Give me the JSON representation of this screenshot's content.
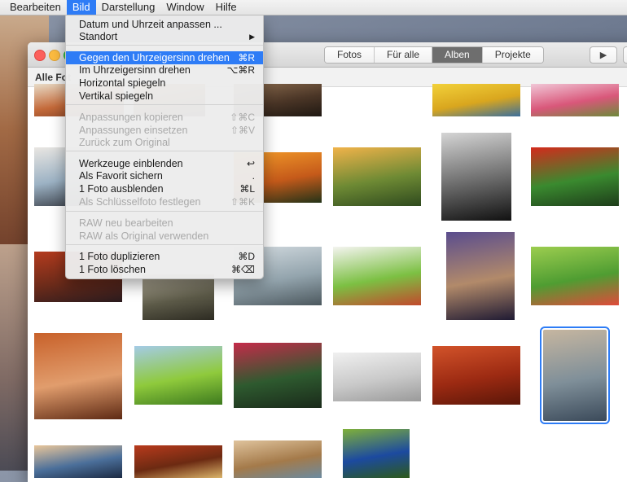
{
  "menubar": {
    "items": [
      "Bearbeiten",
      "Bild",
      "Darstellung",
      "Window",
      "Hilfe"
    ],
    "active_index": 1
  },
  "window": {
    "tabs": [
      "Fotos",
      "Für alle",
      "Alben",
      "Projekte"
    ],
    "active_tab": "Alben",
    "play_icon": "play-icon",
    "breadcrumb": "Alle Fot"
  },
  "bild_menu": {
    "items": [
      {
        "label": "Datum und Uhrzeit anpassen ...",
        "shortcut": "",
        "disabled": false
      },
      {
        "label": "Standort",
        "shortcut": "▶",
        "disabled": false
      },
      {
        "label": "Gegen den Uhrzeigersinn drehen",
        "shortcut": "⌘R",
        "disabled": false,
        "highlighted": true
      },
      {
        "label": "Im Uhrzeigersinn drehen",
        "shortcut": "⌥⌘R",
        "disabled": false
      },
      {
        "label": "Horizontal spiegeln",
        "shortcut": "",
        "disabled": false
      },
      {
        "label": "Vertikal spiegeln",
        "shortcut": "",
        "disabled": false
      },
      {
        "label": "Anpassungen kopieren",
        "shortcut": "⇧⌘C",
        "disabled": true
      },
      {
        "label": "Anpassungen einsetzen",
        "shortcut": "⇧⌘V",
        "disabled": true
      },
      {
        "label": "Zurück zum Original",
        "shortcut": "",
        "disabled": true
      },
      {
        "label": "Werkzeuge einblenden",
        "shortcut": "↩",
        "disabled": false
      },
      {
        "label": "Als Favorit sichern",
        "shortcut": ".",
        "disabled": false
      },
      {
        "label": "1 Foto ausblenden",
        "shortcut": "⌘L",
        "disabled": false
      },
      {
        "label": "Als Schlüsselfoto festlegen",
        "shortcut": "⇧⌘K",
        "disabled": true
      },
      {
        "label": "RAW neu bearbeiten",
        "shortcut": "",
        "disabled": true
      },
      {
        "label": "RAW als Original verwenden",
        "shortcut": "",
        "disabled": true
      },
      {
        "label": "1 Foto duplizieren",
        "shortcut": "⌘D",
        "disabled": false
      },
      {
        "label": "1 Foto löschen",
        "shortcut": "⌘⌫",
        "disabled": false
      }
    ]
  },
  "photos": [
    {
      "name": "photo-swan-dawn",
      "colors": [
        "#e8dcc8",
        "#c46a3a",
        "#7a3c22"
      ]
    },
    {
      "name": "photo-path-sunset",
      "colors": [
        "#d9a25a",
        "#8a5a2b",
        "#3b2a1e"
      ]
    },
    {
      "name": "photo-pier-dusk",
      "colors": [
        "#8a6b4e",
        "#4a3526",
        "#1f1812"
      ]
    },
    {
      "name": "photo-sunflower",
      "colors": [
        "#f2d13a",
        "#d9a61e",
        "#3b6f9c"
      ]
    },
    {
      "name": "photo-pink-flower",
      "colors": [
        "#f1c7d7",
        "#d9577a",
        "#6d8a3a"
      ]
    },
    {
      "name": "photo-laptop-hands",
      "colors": [
        "#e9e6e2",
        "#9cb2c4",
        "#3a3f48"
      ]
    },
    {
      "name": "photo-tree-sunset",
      "colors": [
        "#f39c2a",
        "#c55a1a",
        "#233318"
      ]
    },
    {
      "name": "photo-tree-meadow",
      "colors": [
        "#f1b34a",
        "#6e8a34",
        "#2f4a1e"
      ]
    },
    {
      "name": "photo-old-man-bw",
      "colors": [
        "#d5d5d5",
        "#6a6a6a",
        "#111111"
      ]
    },
    {
      "name": "photo-macaw",
      "colors": [
        "#d42a1c",
        "#3a8a2f",
        "#1e3d1a"
      ]
    },
    {
      "name": "photo-red-dusk-sea",
      "colors": [
        "#b43b1e",
        "#6c2b1a",
        "#2a1b1e"
      ]
    },
    {
      "name": "photo-road-trees",
      "colors": [
        "#b8b19e",
        "#5c5a48",
        "#2d2b22"
      ]
    },
    {
      "name": "photo-car-interior",
      "colors": [
        "#d2dadf",
        "#93a4ad",
        "#4c585e"
      ]
    },
    {
      "name": "photo-celery",
      "colors": [
        "#f4f4f0",
        "#7cc043",
        "#c2492c"
      ]
    },
    {
      "name": "photo-church-storm",
      "colors": [
        "#5a4d8e",
        "#b28a6a",
        "#1f1a33"
      ]
    },
    {
      "name": "photo-green-flower",
      "colors": [
        "#9ccd4f",
        "#4f9d32",
        "#e04a3a"
      ]
    },
    {
      "name": "photo-snake-hand",
      "colors": [
        "#c8612a",
        "#e19d6d",
        "#5e2a14"
      ]
    },
    {
      "name": "photo-grass-sky",
      "colors": [
        "#a4cbe6",
        "#8fca3c",
        "#3d7a1e"
      ]
    },
    {
      "name": "photo-red-protea",
      "colors": [
        "#c52b4a",
        "#2e5a2f",
        "#1a2a1a"
      ]
    },
    {
      "name": "photo-keyboard",
      "colors": [
        "#f0f0f0",
        "#c9c9c9",
        "#9a9a9a"
      ]
    },
    {
      "name": "photo-spiky-texture",
      "colors": [
        "#d2532a",
        "#9c2a12",
        "#5a1608"
      ]
    },
    {
      "name": "photo-runners-road",
      "colors": [
        "#c6b6a0",
        "#7f8f99",
        "#3b4a5a"
      ]
    },
    {
      "name": "photo-sea-clouds",
      "colors": [
        "#e9c69a",
        "#4b6f9a",
        "#1c2b44"
      ]
    },
    {
      "name": "photo-market-food",
      "colors": [
        "#b83a1c",
        "#6c2a12",
        "#d9b36a"
      ]
    },
    {
      "name": "photo-giraffes",
      "colors": [
        "#dfc39c",
        "#a47a4a",
        "#6b8aa0"
      ]
    },
    {
      "name": "photo-peacock",
      "colors": [
        "#7fb03a",
        "#1c4aa0",
        "#2d5a1a"
      ]
    }
  ]
}
